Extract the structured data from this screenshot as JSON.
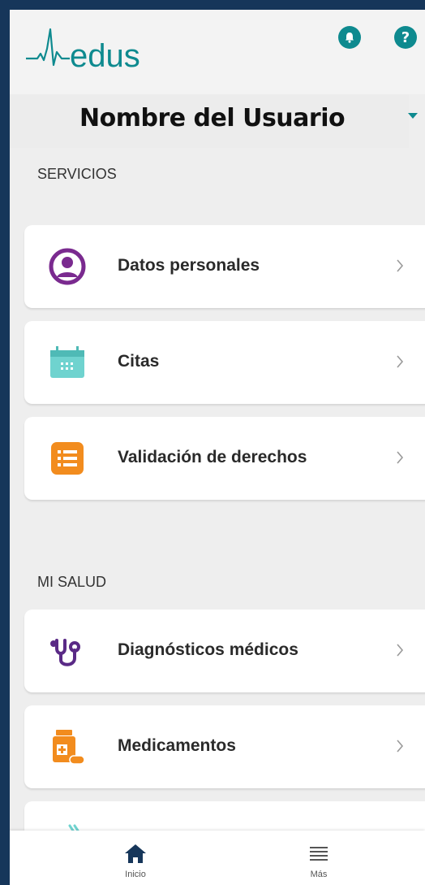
{
  "app": {
    "logo_text": "edus"
  },
  "header": {
    "notifications_icon": "bell-icon",
    "help_icon": "help-icon"
  },
  "user": {
    "name": "Nombre del Usuario"
  },
  "sections": [
    {
      "title": "SERVICIOS",
      "items": [
        {
          "label": "Datos personales",
          "icon": "user-circle-icon"
        },
        {
          "label": "Citas",
          "icon": "calendar-icon"
        },
        {
          "label": "Validación de derechos",
          "icon": "list-icon"
        }
      ]
    },
    {
      "title": "MI SALUD",
      "items": [
        {
          "label": "Diagnósticos médicos",
          "icon": "stethoscope-icon"
        },
        {
          "label": "Medicamentos",
          "icon": "medicine-bottle-icon"
        }
      ]
    }
  ],
  "bottom_nav": [
    {
      "label": "Inicio",
      "icon": "home-icon",
      "active": true
    },
    {
      "label": "Más",
      "icon": "menu-icon",
      "active": false
    }
  ],
  "colors": {
    "brand": "#0e8a8f",
    "outer_background": "#16365a",
    "page_background": "#eeeeee",
    "datos_icon": "#7a2a8f",
    "citas_icon": "#6fd3cf",
    "validacion_icon": "#f28c1e",
    "diagnosticos_icon": "#5a2a86",
    "medicamentos_icon": "#f28c1e"
  }
}
